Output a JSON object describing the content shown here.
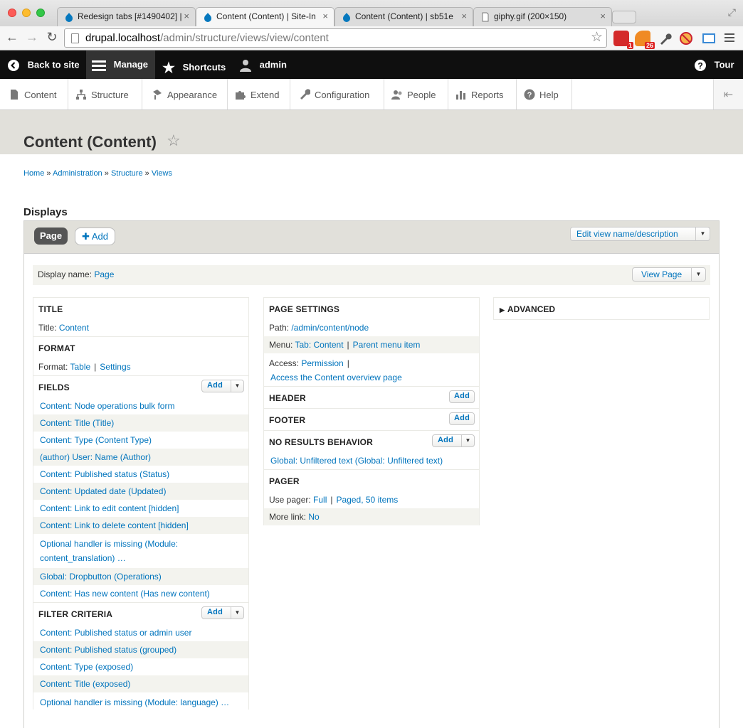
{
  "browser": {
    "tabs": [
      {
        "title": "Redesign tabs [#1490402] |"
      },
      {
        "title": "Content (Content) | Site-In"
      },
      {
        "title": "Content (Content) | sb51e"
      },
      {
        "title": "giphy.gif (200×150)"
      }
    ],
    "url_host": "drupal.localhost",
    "url_path": "/admin/structure/views/view/content",
    "ext_badges": [
      "1",
      "26"
    ]
  },
  "toolbar": {
    "back_to_site": "Back to site",
    "manage": "Manage",
    "shortcuts": "Shortcuts",
    "user": "admin",
    "tour": "Tour"
  },
  "tray": {
    "items": [
      "Content",
      "Structure",
      "Appearance",
      "Extend",
      "Configuration",
      "People",
      "Reports",
      "Help"
    ]
  },
  "page": {
    "title": "Content (Content)",
    "breadcrumb": [
      "Home",
      "Administration",
      "Structure",
      "Views"
    ],
    "breadcrumb_sep": "»",
    "displays_label": "Displays"
  },
  "displays": {
    "active_display": "Page",
    "add_label": "Add",
    "edit_view": "Edit view name/description",
    "display_name_label": "Display name:",
    "display_name": "Page",
    "view_page": "View Page"
  },
  "col1": {
    "title_heading": "TITLE",
    "title_label": "Title:",
    "title_value": "Content",
    "format_heading": "FORMAT",
    "format_label": "Format:",
    "format_value": "Table",
    "format_settings": "Settings",
    "fields_heading": "FIELDS",
    "fields": [
      "Content: Node operations bulk form",
      "Content: Title (Title)",
      "Content: Type (Content Type)",
      "(author) User: Name (Author)",
      "Content: Published status (Status)",
      "Content: Updated date (Updated)",
      "Content: Link to edit content [hidden]",
      "Content: Link to delete content [hidden]",
      "Optional handler is missing (Module: content_translation) …",
      "Global: Dropbutton (Operations)",
      "Content: Has new content (Has new content)"
    ],
    "filter_heading": "FILTER CRITERIA",
    "filters": [
      "Content: Published status or admin user",
      "Content: Published status (grouped)",
      "Content: Type (exposed)",
      "Content: Title (exposed)",
      "Optional handler is missing (Module: language) …"
    ],
    "add": "Add"
  },
  "col2": {
    "page_settings_heading": "PAGE SETTINGS",
    "path_label": "Path:",
    "path_value": "/admin/content/node",
    "menu_label": "Menu:",
    "menu_value": "Tab: Content",
    "menu_parent": "Parent menu item",
    "access_label": "Access:",
    "access_value": "Permission",
    "access_detail": "Access the Content overview page",
    "header_heading": "HEADER",
    "footer_heading": "FOOTER",
    "noresults_heading": "NO RESULTS BEHAVIOR",
    "noresults_item": "Global: Unfiltered text (Global: Unfiltered text)",
    "pager_heading": "PAGER",
    "use_pager_label": "Use pager:",
    "use_pager_value": "Full",
    "pager_items": "Paged, 50 items",
    "more_link_label": "More link:",
    "more_link_value": "No",
    "add": "Add"
  },
  "col3": {
    "advanced": "ADVANCED"
  }
}
